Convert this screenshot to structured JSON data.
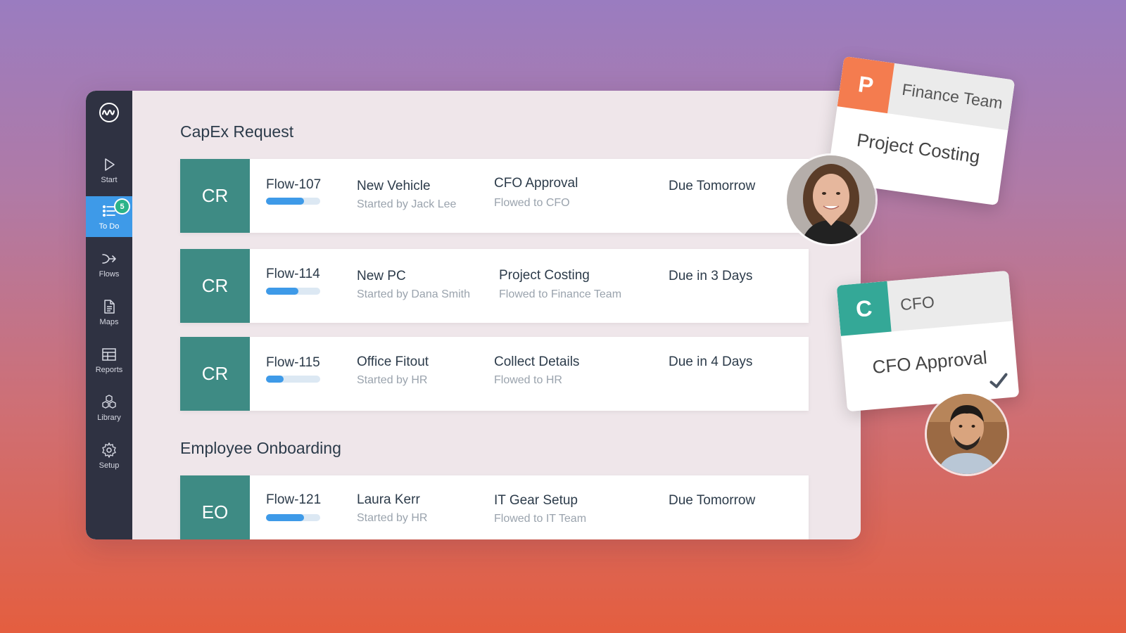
{
  "nav": [
    {
      "label": "Start",
      "icon": "play-icon"
    },
    {
      "label": "To Do",
      "icon": "todo-list-icon",
      "badge": "5",
      "active": true
    },
    {
      "label": "Flows",
      "icon": "flows-icon"
    },
    {
      "label": "Maps",
      "icon": "document-icon"
    },
    {
      "label": "Reports",
      "icon": "table-icon"
    },
    {
      "label": "Library",
      "icon": "boxes-icon"
    },
    {
      "label": "Setup",
      "icon": "gear-icon"
    }
  ],
  "sections": [
    {
      "title": "CapEx Request"
    },
    {
      "title": "Employee Onboarding"
    }
  ],
  "rows": [
    {
      "code": "CR",
      "flow": "Flow-107",
      "progress": 0.7,
      "name": "New Vehicle",
      "started": "Started by Jack Lee",
      "step": "CFO Approval",
      "flowed": "Flowed to CFO",
      "due": "Due Tomorrow"
    },
    {
      "code": "CR",
      "flow": "Flow-114",
      "progress": 0.6,
      "name": "New PC",
      "started": "Started by Dana Smith",
      "step": "Project Costing",
      "flowed": "Flowed to Finance Team",
      "due": "Due in 3 Days"
    },
    {
      "code": "CR",
      "flow": "Flow-115",
      "progress": 0.33,
      "name": "Office Fitout",
      "started": "Started by HR",
      "step": "Collect Details",
      "flowed": "Flowed to HR",
      "due": "Due in 4 Days"
    },
    {
      "code": "EO",
      "flow": "Flow-121",
      "progress": 0.7,
      "name": "Laura Kerr",
      "started": "Started by HR",
      "step": "IT Gear Setup",
      "flowed": "Flowed to IT Team",
      "due": "Due Tomorrow"
    }
  ],
  "cards": [
    {
      "letter": "P",
      "team": "Finance Team",
      "task": "Project Costing",
      "color": "#f47c4f"
    },
    {
      "letter": "C",
      "team": "CFO",
      "task": "CFO Approval",
      "color": "#34a897"
    }
  ],
  "colors": {
    "accent": "#3e9ae8",
    "code_bg": "#3e8b84",
    "badge": "#2bb389"
  }
}
